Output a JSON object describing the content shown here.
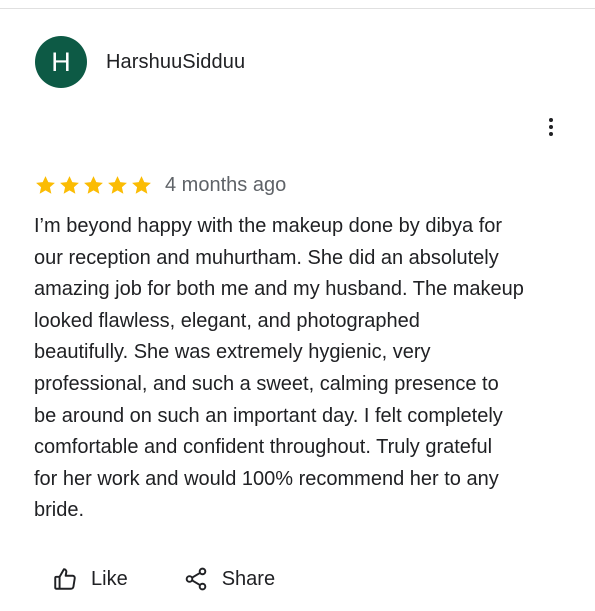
{
  "review": {
    "avatar_initial": "H",
    "username": "HarshuuSidduu",
    "rating": 5,
    "rating_max": 5,
    "time_ago": "4 months ago",
    "text_lines": [
      "I’m beyond happy with the makeup done by dibya for",
      "our reception and muhurtham. She did an absolutely",
      "amazing job for both me and my husband. The makeup",
      "looked flawless, elegant, and photographed",
      "beautifully. She was extremely hygienic, very",
      "professional, and such a sweet, calming presence to",
      "be around on such an important day. I felt completely",
      "comfortable and confident throughout. Truly grateful",
      "for her work and would 100% recommend her to any",
      "bride."
    ]
  },
  "actions": {
    "like_label": "Like",
    "share_label": "Share"
  },
  "icons": {
    "more": "more-vert-icon",
    "star": "star-icon",
    "like": "thumb-up-icon",
    "share": "share-icon"
  },
  "colors": {
    "avatar_bg": "#0d5a45",
    "star": "#fbbc04",
    "text": "#202124",
    "muted": "#5f6368"
  }
}
